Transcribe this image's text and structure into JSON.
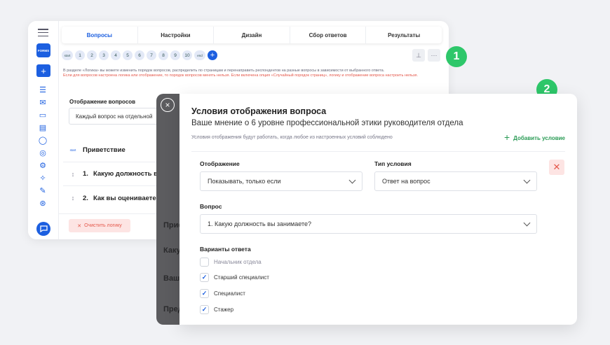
{
  "back": {
    "logo_text": "FORMS",
    "tabs": [
      {
        "label": "Вопросы",
        "active": true
      },
      {
        "label": "Настройки",
        "active": false
      },
      {
        "label": "Дизайн",
        "active": false
      },
      {
        "label": "Сбор ответов",
        "active": false
      },
      {
        "label": "Результаты",
        "active": false
      }
    ],
    "question_nav": [
      "start",
      "1",
      "2",
      "3",
      "4",
      "5",
      "6",
      "7",
      "8",
      "9",
      "10",
      "end"
    ],
    "info_text": "В разделе «Логика» вы можете изменить порядок вопросов, распределить по страницам и перенаправить респондентов на разные вопросы в зависимости от выбранного ответа.",
    "warning_text": "Если для вопросов настроена логика или отображение, то порядок вопросов менять нельзя. Если включена опция «Случайный порядок страниц», логику и отображение вопроса настроить нельзя.",
    "display_label": "Отображение вопросов",
    "display_value": "Каждый вопрос на отдельной",
    "start_tag": "start",
    "greeting": "Приветствие",
    "q1": {
      "num": "1.",
      "text": "Какую должность в"
    },
    "q2": {
      "num": "2.",
      "text": "Как вы оцениваете"
    },
    "clear_logic": "Очистить логику"
  },
  "badges": {
    "first": "1",
    "second": "2"
  },
  "overlay": {
    "ghost1": "Прие",
    "ghost2": "Каку",
    "ghost3": "Ваш",
    "ghost4": "Пред"
  },
  "modal": {
    "title": "Условия отображения вопроса",
    "subtitle": "Ваше мнение о 6 уровне профессиональной этики руководителя отдела",
    "hint": "Условия отображения будут работать, когда любое из настроенных условий соблюдено",
    "add_condition": "Добавить условие",
    "display_label": "Отображение",
    "display_value": "Показывать, только если",
    "condition_type_label": "Тип условия",
    "condition_type_value": "Ответ на вопрос",
    "question_label": "Вопрос",
    "question_value": "1. Какую должность вы занимаете?",
    "answers_label": "Варианты ответа",
    "answers": [
      {
        "label": "Начальник отдела",
        "checked": false
      },
      {
        "label": "Старший специалист",
        "checked": true
      },
      {
        "label": "Специалист",
        "checked": true
      },
      {
        "label": "Стажер",
        "checked": true
      }
    ]
  },
  "colors": {
    "accent": "#1c5fe0",
    "success": "#2ec76a",
    "danger": "#e4574a"
  }
}
